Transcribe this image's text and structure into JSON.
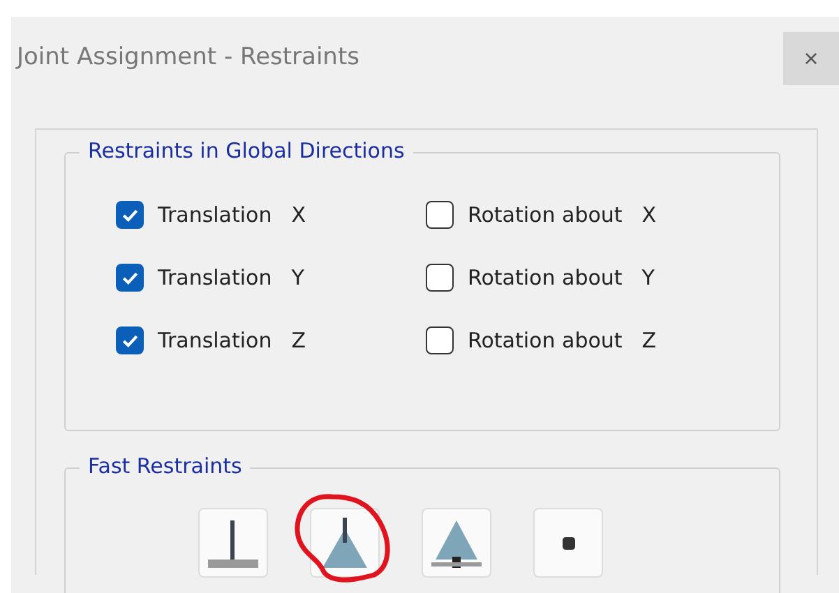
{
  "window": {
    "title": "Joint Assignment - Restraints",
    "close": "×"
  },
  "global_restraints": {
    "title": "Restraints in Global Directions",
    "options": [
      {
        "label": "Translation",
        "axis": "X",
        "checked": true
      },
      {
        "label": "Rotation about",
        "axis": "X",
        "checked": false
      },
      {
        "label": "Translation",
        "axis": "Y",
        "checked": true
      },
      {
        "label": "Rotation about",
        "axis": "Y",
        "checked": false
      },
      {
        "label": "Translation",
        "axis": "Z",
        "checked": true
      },
      {
        "label": "Rotation about",
        "axis": "Z",
        "checked": false
      }
    ]
  },
  "fast_restraints": {
    "title": "Fast Restraints",
    "buttons": [
      {
        "kind": "fixed",
        "circled": false
      },
      {
        "kind": "pinned",
        "circled": true
      },
      {
        "kind": "roller",
        "circled": false
      },
      {
        "kind": "free",
        "circled": false
      }
    ]
  }
}
